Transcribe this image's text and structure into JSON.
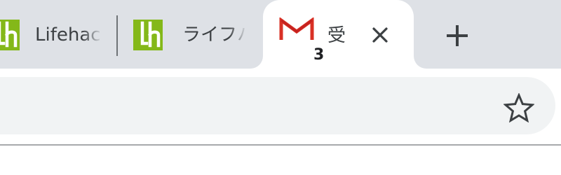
{
  "tabs": [
    {
      "title": "Lifehacker",
      "favicon": "lifehacker-lh-icon",
      "active": false
    },
    {
      "title": "ライフハッカー",
      "favicon": "lifehacker-lh-icon",
      "active": false
    },
    {
      "title": "受",
      "favicon": "gmail-icon",
      "badge": "3",
      "active": true,
      "close_icon": "close-icon"
    }
  ],
  "tab_strip": {
    "new_tab_icon": "plus-icon"
  },
  "toolbar": {
    "bookmark_icon": "star-icon"
  },
  "colors": {
    "tab_strip_bg": "#dee1e6",
    "active_tab_bg": "#ffffff",
    "omnibox_bg": "#f1f3f4",
    "lifehacker_green": "#84b819",
    "gmail_red": "#d93025",
    "text": "#3c4043"
  }
}
